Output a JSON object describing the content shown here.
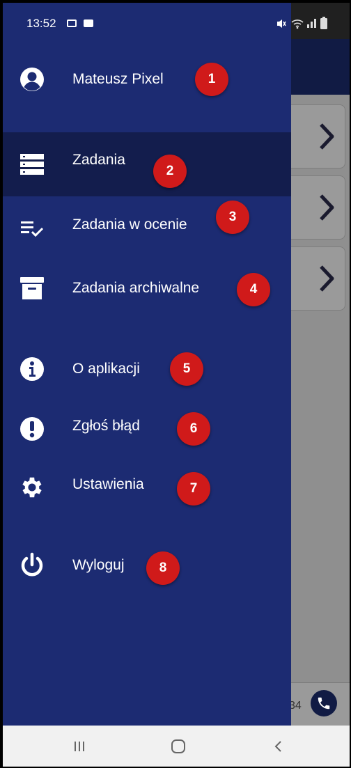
{
  "status_bar": {
    "time": "13:52",
    "icons": [
      "calendar-icon",
      "checkbox-icon",
      "mute-icon",
      "wifi-icon",
      "signal-icon",
      "battery-icon"
    ]
  },
  "user": {
    "name": "Mateusz Pixel",
    "badge": "1"
  },
  "menu": {
    "items": [
      {
        "label": "Zadania",
        "icon": "list-icon",
        "badge": "2",
        "active": true
      },
      {
        "label": "Zadania w ocenie",
        "icon": "checklist-icon",
        "badge": "3"
      },
      {
        "label": "Zadania archiwalne",
        "icon": "archive-icon",
        "badge": "4"
      },
      {
        "label": "O aplikacji",
        "icon": "info-icon",
        "badge": "5"
      },
      {
        "label": "Zgłoś błąd",
        "icon": "alert-icon",
        "badge": "6"
      },
      {
        "label": "Ustawienia",
        "icon": "gear-icon",
        "badge": "7"
      },
      {
        "label": "Wyloguj",
        "icon": "power-icon",
        "badge": "8"
      }
    ]
  },
  "background_app": {
    "footer_number": "34"
  },
  "colors": {
    "drawer": "#1c2b72",
    "active_item": "#131d4d",
    "header": "#111b44",
    "badge": "#d01a1a"
  }
}
